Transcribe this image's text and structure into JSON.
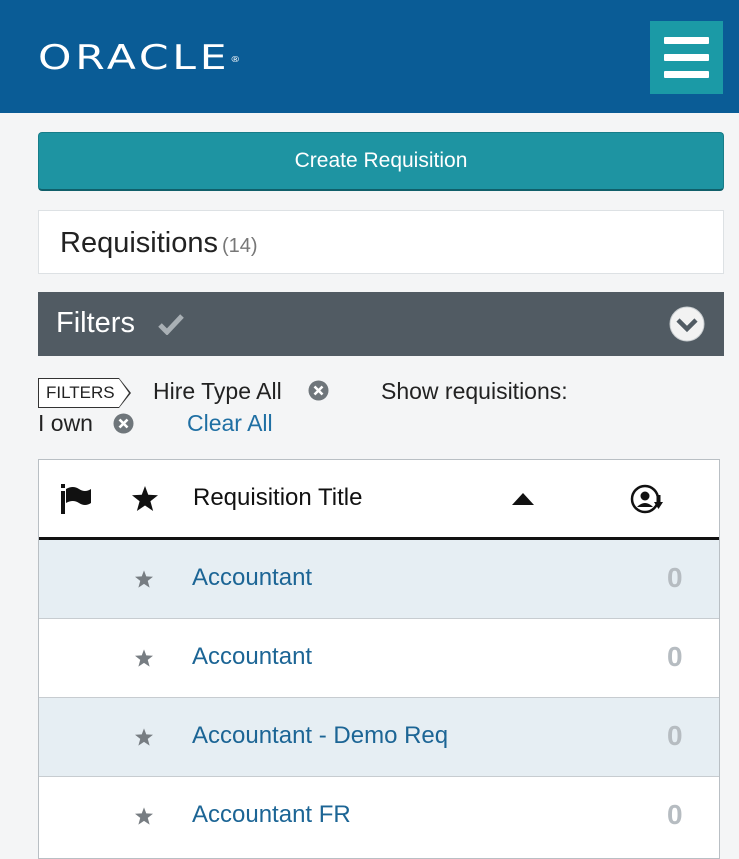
{
  "header": {
    "logo": "ORACLE",
    "menu_label": "menu"
  },
  "create_button": "Create Requisition",
  "requisitions": {
    "title": "Requisitions",
    "count": "(14)"
  },
  "filters_panel": {
    "title": "Filters"
  },
  "active_filters": {
    "tag": "FILTERS",
    "hire_type": "Hire Type All",
    "show_label": "Show requisitions:",
    "show_value": "I own",
    "clear_all": "Clear All"
  },
  "table": {
    "columns": [
      "flag",
      "favorite",
      "Requisition Title",
      "sort-ascending",
      "candidates"
    ],
    "title_header": "Requisition Title",
    "rows": [
      {
        "title": "Accountant",
        "count": "0"
      },
      {
        "title": "Accountant",
        "count": "0"
      },
      {
        "title": "Accountant - Demo Req",
        "count": "0"
      },
      {
        "title": "Accountant FR",
        "count": "0"
      }
    ]
  },
  "colors": {
    "header_bg": "#0a5c96",
    "accent_teal": "#1e94a2",
    "filters_bar": "#515b63",
    "link": "#1c6595",
    "row_alt": "#e6eef3"
  }
}
